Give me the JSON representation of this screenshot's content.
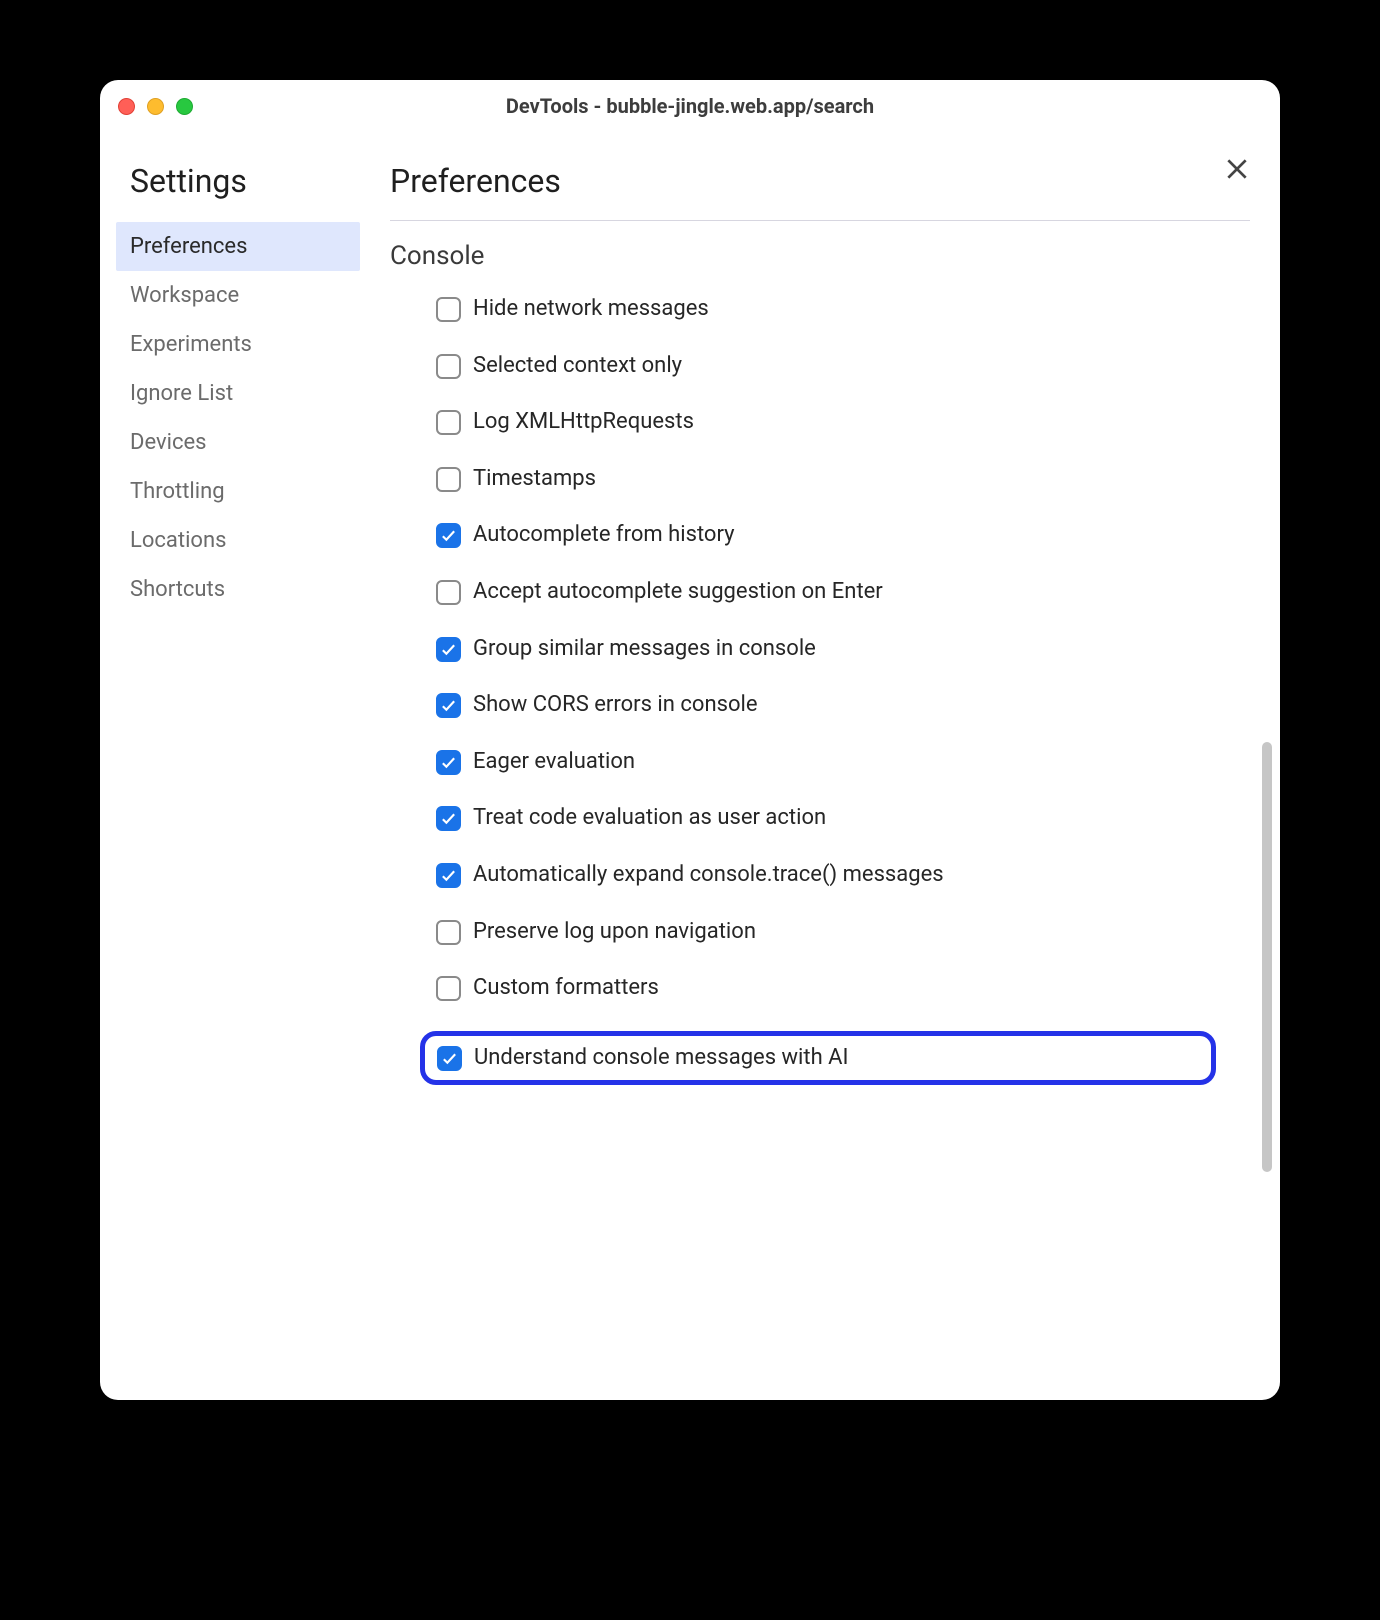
{
  "window": {
    "title": "DevTools - bubble-jingle.web.app/search"
  },
  "sidebar": {
    "title": "Settings",
    "items": [
      {
        "label": "Preferences",
        "selected": true
      },
      {
        "label": "Workspace",
        "selected": false
      },
      {
        "label": "Experiments",
        "selected": false
      },
      {
        "label": "Ignore List",
        "selected": false
      },
      {
        "label": "Devices",
        "selected": false
      },
      {
        "label": "Throttling",
        "selected": false
      },
      {
        "label": "Locations",
        "selected": false
      },
      {
        "label": "Shortcuts",
        "selected": false
      }
    ]
  },
  "main": {
    "title": "Preferences",
    "section": "Console",
    "options": [
      {
        "label": "Hide network messages",
        "checked": false,
        "highlight": false
      },
      {
        "label": "Selected context only",
        "checked": false,
        "highlight": false
      },
      {
        "label": "Log XMLHttpRequests",
        "checked": false,
        "highlight": false
      },
      {
        "label": "Timestamps",
        "checked": false,
        "highlight": false
      },
      {
        "label": "Autocomplete from history",
        "checked": true,
        "highlight": false
      },
      {
        "label": "Accept autocomplete suggestion on Enter",
        "checked": false,
        "highlight": false
      },
      {
        "label": "Group similar messages in console",
        "checked": true,
        "highlight": false
      },
      {
        "label": "Show CORS errors in console",
        "checked": true,
        "highlight": false
      },
      {
        "label": "Eager evaluation",
        "checked": true,
        "highlight": false
      },
      {
        "label": "Treat code evaluation as user action",
        "checked": true,
        "highlight": false
      },
      {
        "label": "Automatically expand console.trace() messages",
        "checked": true,
        "highlight": false
      },
      {
        "label": "Preserve log upon navigation",
        "checked": false,
        "highlight": false
      },
      {
        "label": "Custom formatters",
        "checked": false,
        "highlight": false
      },
      {
        "label": "Understand console messages with AI",
        "checked": true,
        "highlight": true
      }
    ]
  }
}
